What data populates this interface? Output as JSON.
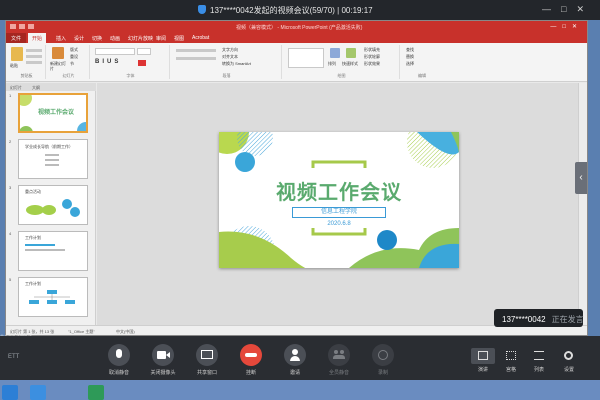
{
  "meeting": {
    "title": "137****0042发起的视频会议(59/70) | 00:19:17",
    "speaker_id": "137****0042",
    "speaker_status": "正在发言",
    "brand": "ETT",
    "controls": [
      {
        "name": "mute-button",
        "label": "取消静音",
        "icon": "microphone-icon",
        "enabled": true,
        "danger": false
      },
      {
        "name": "camera-button",
        "label": "关闭摄像头",
        "icon": "camera-icon",
        "enabled": true,
        "danger": false
      },
      {
        "name": "share-window-button",
        "label": "共享窗口",
        "icon": "share-icon",
        "enabled": true,
        "danger": false
      },
      {
        "name": "hangup-button",
        "label": "挂断",
        "icon": "phone-icon",
        "enabled": true,
        "danger": true
      },
      {
        "name": "invite-button",
        "label": "邀请",
        "icon": "add-user-icon",
        "enabled": true,
        "danger": false
      },
      {
        "name": "mute-all-button",
        "label": "全员静音",
        "icon": "group-icon",
        "enabled": false,
        "danger": false
      },
      {
        "name": "record-button",
        "label": "录制",
        "icon": "record-icon",
        "enabled": false,
        "danger": false
      }
    ],
    "view_controls": [
      {
        "name": "speaker-view-button",
        "label": "演讲",
        "icon": "speaker-view-icon",
        "selected": true
      },
      {
        "name": "gallery-view-button",
        "label": "宫格",
        "icon": "grid-icon",
        "selected": false
      },
      {
        "name": "list-view-button",
        "label": "列表",
        "icon": "list-icon",
        "selected": false
      },
      {
        "name": "settings-button",
        "label": "设置",
        "icon": "gear-icon",
        "selected": false
      }
    ]
  },
  "ppt": {
    "window_title": "视频（兼容模式） - Microsoft PowerPoint (产品激活失败)",
    "tabs": [
      "文件",
      "开始",
      "插入",
      "设计",
      "切换",
      "动画",
      "幻灯片放映",
      "审阅",
      "视图",
      "Acrobat"
    ],
    "active_tab": "开始",
    "ribbon_groups": [
      "剪贴板",
      "幻灯片",
      "字体",
      "段落",
      "绘图",
      "编辑"
    ],
    "ribbon_buttons": {
      "paste": "粘贴",
      "new_slide": "新建幻灯片",
      "layout": "版式",
      "reset": "重设",
      "section": "节",
      "text_direction": "文字方向",
      "align_text": "对齐文本",
      "smartart": "转换为 SmartArt",
      "arrange": "排列",
      "quick_styles": "快速样式",
      "shape_fill": "形状填充",
      "shape_outline": "形状轮廓",
      "shape_effects": "形状效果",
      "find": "查找",
      "replace": "替换",
      "select": "选择"
    },
    "pane_tabs": [
      "幻灯片",
      "大纲"
    ],
    "thumbnails": [
      {
        "num": "1",
        "title": "视频工作会议",
        "selected": true
      },
      {
        "num": "2",
        "title": "学业成长导航（前期工作）",
        "selected": false
      },
      {
        "num": "3",
        "title": "重点活动",
        "selected": false
      },
      {
        "num": "4",
        "title": "工作计划",
        "selected": false
      },
      {
        "num": "5",
        "title": "工作计划",
        "selected": false
      }
    ],
    "slide": {
      "title": "视频工作会议",
      "subtitle": "信息工程学院",
      "date": "2020.6.8"
    },
    "status": {
      "slide_info": "幻灯片 第 1 张，共 13 张",
      "theme": "\"1_Office 主题\"",
      "language": "中文(中国)"
    },
    "notes_hint": "单击此处添加备注"
  },
  "desktop": {
    "text": "ETT"
  }
}
